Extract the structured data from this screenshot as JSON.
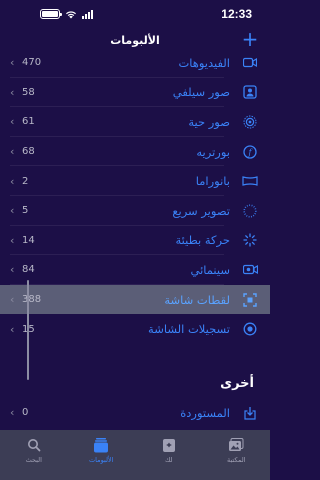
{
  "status": {
    "time": "12:33"
  },
  "nav": {
    "title": "الألبومات",
    "add_label": "+"
  },
  "albums": [
    {
      "label": "الفيديوهات",
      "count": "470",
      "icon": "video-icon"
    },
    {
      "label": "صور سيلفي",
      "count": "58",
      "icon": "selfie-icon"
    },
    {
      "label": "صور حية",
      "count": "61",
      "icon": "live-photo-icon"
    },
    {
      "label": "بورتريه",
      "count": "68",
      "icon": "portrait-icon"
    },
    {
      "label": "بانوراما",
      "count": "2",
      "icon": "panorama-icon"
    },
    {
      "label": "تصوير سريع",
      "count": "5",
      "icon": "timelapse-icon"
    },
    {
      "label": "حركة بطيئة",
      "count": "14",
      "icon": "slomo-icon"
    },
    {
      "label": "سينمائي",
      "count": "84",
      "icon": "cinematic-icon"
    },
    {
      "label": "لقطات شاشة",
      "count": "388",
      "icon": "screenshot-icon"
    },
    {
      "label": "تسجيلات الشاشة",
      "count": "15",
      "icon": "screen-recording-icon"
    }
  ],
  "other": {
    "header": "أخرى",
    "items": [
      {
        "label": "المستوردة",
        "count": "0",
        "icon": "import-icon"
      }
    ]
  },
  "tabs": [
    {
      "label": "البحث",
      "icon": "search-icon"
    },
    {
      "label": "الألبومات",
      "icon": "albums-icon",
      "active": true
    },
    {
      "label": "لك",
      "icon": "for-you-icon"
    },
    {
      "label": "المكتبة",
      "icon": "library-icon"
    }
  ],
  "colors": {
    "accent": "#3a82f7",
    "background": "#1c0f47",
    "selected_row": "#5b5e77",
    "tab_bar": "#3c3d55"
  }
}
